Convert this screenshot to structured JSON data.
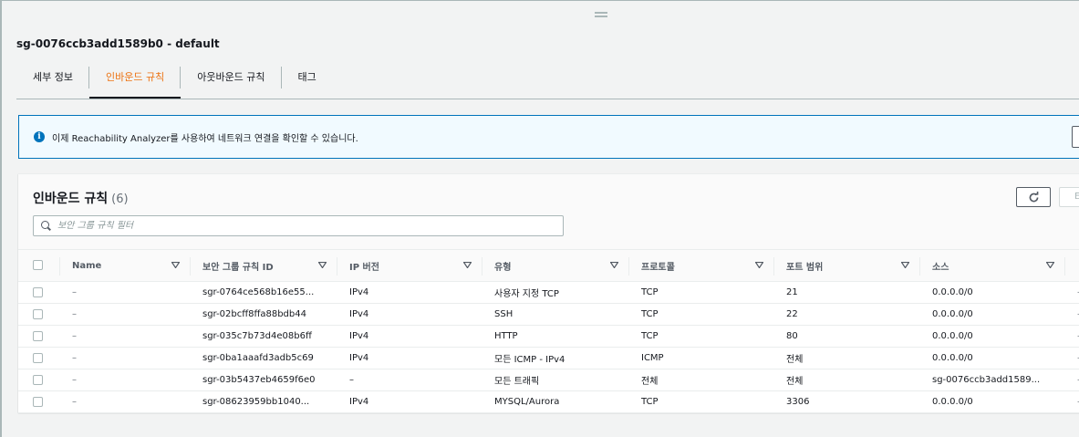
{
  "sg_title": "sg-0076ccb3add1589b0 - default",
  "tabs": [
    {
      "label": "세부 정보",
      "active": false
    },
    {
      "label": "인바운드 규칙",
      "active": true
    },
    {
      "label": "아웃바운드 규칙",
      "active": false
    },
    {
      "label": "태그",
      "active": false
    }
  ],
  "flash": {
    "icon": "info-icon",
    "message": "이제 Reachability Analyzer를 사용하여 네트워크 연결을 확인할 수 있습니다."
  },
  "panel": {
    "title": "인바운드 규칙",
    "count": "(6)",
    "edit_label": "E",
    "search_placeholder": "보안 그룹 규칙 필터"
  },
  "columns": [
    "Name",
    "보안 그룹 규칙 ID",
    "IP 버전",
    "유형",
    "프로토콜",
    "포트 범위",
    "소스"
  ],
  "rows": [
    {
      "name": "–",
      "rule_id": "sgr-0764ce568b16e55...",
      "ip_version": "IPv4",
      "type": "사용자 지정 TCP",
      "protocol": "TCP",
      "port": "21",
      "source": "0.0.0.0/0",
      "tail": "–"
    },
    {
      "name": "–",
      "rule_id": "sgr-02bcff8ffa88bdb44",
      "ip_version": "IPv4",
      "type": "SSH",
      "protocol": "TCP",
      "port": "22",
      "source": "0.0.0.0/0",
      "tail": "–"
    },
    {
      "name": "–",
      "rule_id": "sgr-035c7b73d4e08b6ff",
      "ip_version": "IPv4",
      "type": "HTTP",
      "protocol": "TCP",
      "port": "80",
      "source": "0.0.0.0/0",
      "tail": "–"
    },
    {
      "name": "–",
      "rule_id": "sgr-0ba1aaafd3adb5c69",
      "ip_version": "IPv4",
      "type": "모든 ICMP - IPv4",
      "protocol": "ICMP",
      "port": "전체",
      "source": "0.0.0.0/0",
      "tail": "–"
    },
    {
      "name": "–",
      "rule_id": "sgr-03b5437eb4659f6e0",
      "ip_version": "–",
      "type": "모든 트래픽",
      "protocol": "전체",
      "port": "전체",
      "source": "sg-0076ccb3add1589...",
      "tail": "–"
    },
    {
      "name": "–",
      "rule_id": "sgr-08623959bb1040...",
      "ip_version": "IPv4",
      "type": "MYSQL/Aurora",
      "protocol": "TCP",
      "port": "3306",
      "source": "0.0.0.0/0",
      "tail": "–"
    }
  ],
  "colors": {
    "accent": "#ec7211",
    "info": "#0073bb",
    "info_bg": "#f1faff"
  }
}
